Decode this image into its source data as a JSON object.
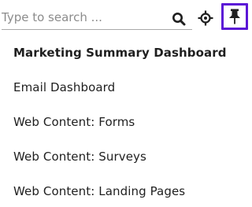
{
  "search": {
    "placeholder": "Type to search ...",
    "value": ""
  },
  "toolbar": {
    "search_icon": "search-icon",
    "locate_icon": "crosshair-icon",
    "pin_icon": "pin-icon",
    "pin_active_color": "#5b16d6"
  },
  "menu": {
    "items": [
      {
        "label": "Marketing Summary Dashboard",
        "active": true
      },
      {
        "label": "Email Dashboard"
      },
      {
        "label": "Web Content: Forms"
      },
      {
        "label": "Web Content: Surveys"
      },
      {
        "label": "Web Content: Landing Pages"
      }
    ]
  }
}
